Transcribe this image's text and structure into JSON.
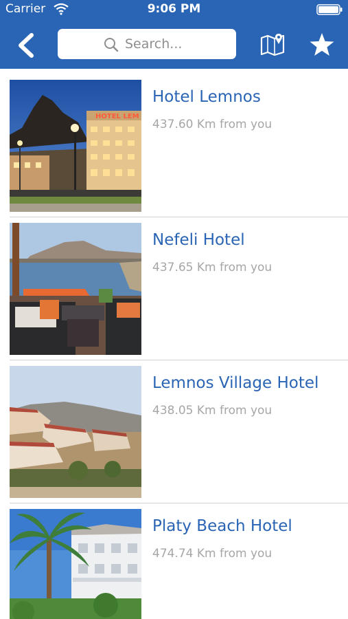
{
  "status_bar": {
    "carrier": "Carrier",
    "time": "9:06 PM"
  },
  "nav": {
    "back_icon": "chevron-left-icon",
    "search_placeholder": "Search...",
    "map_icon": "map-pin-icon",
    "favorites_icon": "star-icon",
    "bar_color": "#2a64b4"
  },
  "hotels": [
    {
      "name": "Hotel Lemnos",
      "distance": "437.60 Km from you",
      "photo": "hotel-night-facade"
    },
    {
      "name": "Nefeli Hotel",
      "distance": "437.65 Km from you",
      "photo": "bay-view-terrace"
    },
    {
      "name": "Lemnos Village Hotel",
      "distance": "438.05 Km from you",
      "photo": "hillside-villas"
    },
    {
      "name": "Platy Beach Hotel",
      "distance": "474.74 Km from you",
      "photo": "palm-tree-hotel"
    }
  ]
}
